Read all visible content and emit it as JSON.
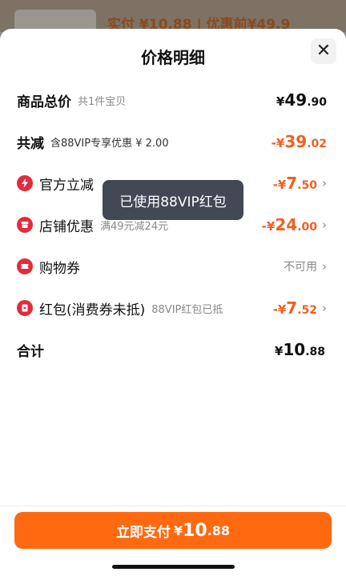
{
  "background": {
    "summary_text": "实付 ¥10.88 | 优惠前¥49.9"
  },
  "sheet": {
    "title": "价格明细",
    "close_icon": "close-icon"
  },
  "rows": {
    "total_goods": {
      "label": "商品总价",
      "sub": "共1件宝贝",
      "currency": "¥",
      "int": "49",
      "dec": ".90"
    },
    "total_discount": {
      "label": "共减",
      "sub": "含88VIP专享优惠 ¥ 2.00",
      "currency": "-¥",
      "int": "39",
      "dec": ".02"
    },
    "official": {
      "label": "官方立减",
      "currency": "-¥",
      "int": "7",
      "dec": ".50",
      "icon": "lightning-icon"
    },
    "store": {
      "label": "店铺优惠",
      "sub": "满49元减24元",
      "currency": "-¥",
      "int": "24",
      "dec": ".00",
      "icon": "store-icon"
    },
    "coupon": {
      "label": "购物券",
      "status": "不可用",
      "icon": "ticket-icon"
    },
    "redpacket": {
      "label": "红包(消费券未抵)",
      "sub": "88VIP红包已抵",
      "currency": "-¥",
      "int": "7",
      "dec": ".52",
      "icon": "red-packet-icon"
    },
    "subtotal": {
      "label": "合计",
      "currency": "¥",
      "int": "10",
      "dec": ".88"
    }
  },
  "toast": {
    "text": "已使用88VIP红包"
  },
  "pay_button": {
    "label": "立即支付",
    "currency": "¥",
    "int": "10",
    "dec": ".88"
  },
  "colors": {
    "accent": "#ff6a10",
    "discount": "#f0601e",
    "icon_red": "#e22c3c"
  }
}
